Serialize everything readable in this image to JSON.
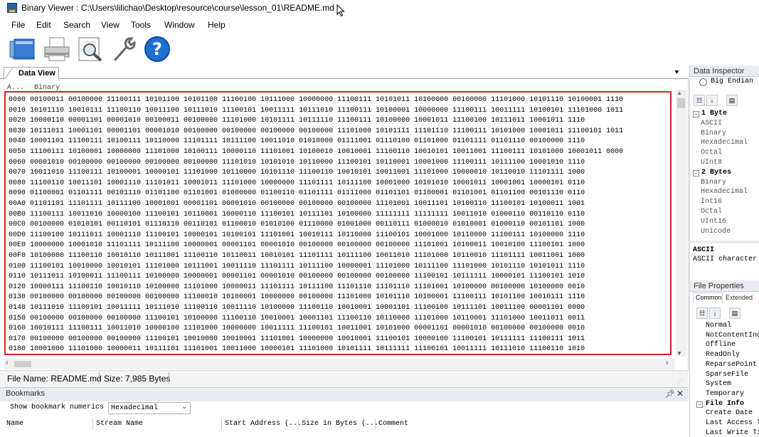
{
  "window": {
    "title": "Binary Viewer : C:\\Users\\lilichao\\Desktop\\resource\\course\\lesson_01\\README.md"
  },
  "menu": [
    "File",
    "Edit",
    "Search",
    "View",
    "Tools",
    "Window",
    "Help"
  ],
  "toolbar": {
    "icons": [
      "open-folder-icon",
      "print-icon",
      "find-icon",
      "tools-icon",
      "help-icon"
    ],
    "colors": {
      "help": "#1e6fd0",
      "folder": "#3b7fd1"
    }
  },
  "data_view": {
    "tab_label": "Data View",
    "col_address": "A...",
    "col_binary": "Binary",
    "rows": [
      {
        "addr": "0000",
        "bytes": "00100011 00100000 11100111 10101100 10101100 11100100 10111000 10000000 11100111 10101011 10100000 00100000 11101000 10101110 10100001 1110"
      },
      {
        "addr": "0010",
        "bytes": "10101110 10010111 11100110 10011100 10111010 11100101 10011111 10111010 11100111 10100001 10000000 11100111 10011111 10100101 11101000 1011"
      },
      {
        "addr": "0020",
        "bytes": "10000110 00001101 00001010 00100011 00100000 11101000 10101111 10111110 11100111 10100000 10001011 11100100 10111011 10001011 1110"
      },
      {
        "addr": "0030",
        "bytes": "10111011 10001101 00001101 00001010 00100000 00100000 00100000 00100000 11101000 10101111 11101110 11100111 10101000 10001011 11100101 1011"
      },
      {
        "addr": "0040",
        "bytes": "10001101 11100111 10100111 10110000 11101111 10111100 10011010 01010000 01111001 01110100 01101000 01101111 01101110 00100000 1110"
      },
      {
        "addr": "0050",
        "bytes": "11100111 10100001 10000000 11101000 10100111 10000110 11101001 10100010 10010001 11100110 10010101 10011001 11100111 10101000 10001011 0000"
      },
      {
        "addr": "0060",
        "bytes": "00001010 00100000 00100000 00100000 00100000 11101010 10101010 10110000 11100101 10110001 10001000 11100111 10111100 10001010 1110"
      },
      {
        "addr": "0070",
        "bytes": "10011010 11100111 10100001 10000101 11101000 10110000 10101110 11100110 10010101 10011001 11101000 10000010 10110010 11101111 1000"
      },
      {
        "addr": "0080",
        "bytes": "11100110 10011101 10001110 11101011 10001011 11101000 10000000 11101111 10111100 10001000 10101010 10001011 10001001 10000101 0110"
      },
      {
        "addr": "0090",
        "bytes": "01100001 01101111 00101110 01101100 01101001 01000000 01100110 01101111 01111000 01101101 01100001 01101001 01101100 00101110 0110"
      },
      {
        "addr": "00A0",
        "bytes": "01101101 11101111 10111100 10001001 00001101 00001010 00100000 00100000 00100000 11101001 10011101 10100110 11100101 10100011 1001"
      },
      {
        "addr": "00B0",
        "bytes": "11100111 10011010 10000100 11100101 10110001 10000110 11100101 10111101 10100000 11111111 11111111 10011010 01000110 00110110 0110"
      },
      {
        "addr": "00C0",
        "bytes": "00100000 01010101 00110101 01110110 00110101 01100010 01010100 01110000 01001000 00110111 01000010 01010001 01000110 00101101 1000"
      },
      {
        "addr": "00D0",
        "bytes": "11100100 10111011 10001110 11100101 10000101 10100101 11101001 10010111 10110000 11100101 10001000 10110000 11100111 10100000 1110"
      },
      {
        "addr": "00E0",
        "bytes": "10000000 10001010 11101111 10111100 10000001 00001101 00001010 00100000 00100000 00100000 11101001 10100011 10010100 11100101 1000"
      },
      {
        "addr": "00F0",
        "bytes": "10100000 11100110 10010110 10111001 11100110 10110011 10010101 11101111 10111100 10011010 11101000 10110010 11101111 10011001 1000"
      },
      {
        "addr": "0100",
        "bytes": "11100101 10010000 10010101 11101000 10111001 10011110 11101111 10111100 10000001 11101000 10111100 11101000 10101110 10101011 1110"
      },
      {
        "addr": "0110",
        "bytes": "10111011 10100011 11100111 10100000 10000001 00001101 00001010 00100000 00100000 00100000 11100101 10111111 10000101 11100101 1010"
      },
      {
        "addr": "0120",
        "bytes": "10000111 11100110 10010110 10100000 11101000 10000011 11101111 10111100 11101110 11101110 11101001 10100000 00100000 10100000 0010"
      },
      {
        "addr": "0130",
        "bytes": "00100000 00100000 00100000 00100000 11100010 10100001 10000000 00100000 11101000 10101110 10100001 11100111 10101100 10010111 1110"
      },
      {
        "addr": "0140",
        "bytes": "10111010 11100101 10011111 10111010 11100110 10011110 10100000 11100110 10010001 10001101 11100100 10111101 10011100 00001101 0000"
      },
      {
        "addr": "0150",
        "bytes": "00100000 00100000 00100000 11100101 10100000 11100110 10010001 10001101 11100110 10110000 11101000 10110001 11101000 10011011 0011"
      },
      {
        "addr": "0160",
        "bytes": "10010111 11100111 10011010 10000100 11101000 10000000 10011111 11100101 10011001 10101000 00001101 00001010 00100000 00100000 0010"
      },
      {
        "addr": "0170",
        "bytes": "00100000 00100000 00100000 11100101 10010000 10010001 11101001 10000000 10010001 11100101 10000100 11100101 10111111 11100111 1011"
      },
      {
        "addr": "0180",
        "bytes": "10001000 11101000 10000011 10111101 11101001 10011000 10000101 11101000 10101111 10111111 11100101 10011111 10111010 11100110 1010"
      }
    ]
  },
  "status": {
    "filename": "File Name: README.md",
    "size": "Size: 7,985 Bytes"
  },
  "bookmarks": {
    "title": "Bookmarks",
    "show_label": "Show bookmark numerics as",
    "select_value": "Hexadecimal",
    "columns": [
      "Name",
      "Stream Name",
      "Start Address (...",
      "Size in Bytes (...",
      "Comment"
    ]
  },
  "data_inspector": {
    "title": "Data Inspector",
    "endian_label": "Big Endian",
    "tree": [
      {
        "label": "1 Byte",
        "kind": "group"
      },
      {
        "label": "ASCII",
        "kind": "item"
      },
      {
        "label": "Binary",
        "kind": "item"
      },
      {
        "label": "Hexadecimal",
        "kind": "item"
      },
      {
        "label": "Octal",
        "kind": "item"
      },
      {
        "label": "UInt8",
        "kind": "item"
      },
      {
        "label": "2 Bytes",
        "kind": "group"
      },
      {
        "label": "Binary",
        "kind": "item"
      },
      {
        "label": "Hexadecimal",
        "kind": "item"
      },
      {
        "label": "Int16",
        "kind": "item"
      },
      {
        "label": "Octal",
        "kind": "item"
      },
      {
        "label": "UInt16",
        "kind": "item"
      },
      {
        "label": "Unicode",
        "kind": "item"
      }
    ],
    "desc_title": "ASCII",
    "desc_text": "ASCII character"
  },
  "file_properties": {
    "title": "File Properties",
    "tab_common": "Common",
    "tab_extended": "Extended",
    "items": [
      "Normal",
      "NotContentInde",
      "Offline",
      "ReadOnly",
      "ReparsePoint",
      "SparseFile",
      "System",
      "Temporary"
    ],
    "group": "File Info",
    "info_items": [
      "Create Date",
      "Last Access Ti",
      "Last Write Tim"
    ]
  }
}
